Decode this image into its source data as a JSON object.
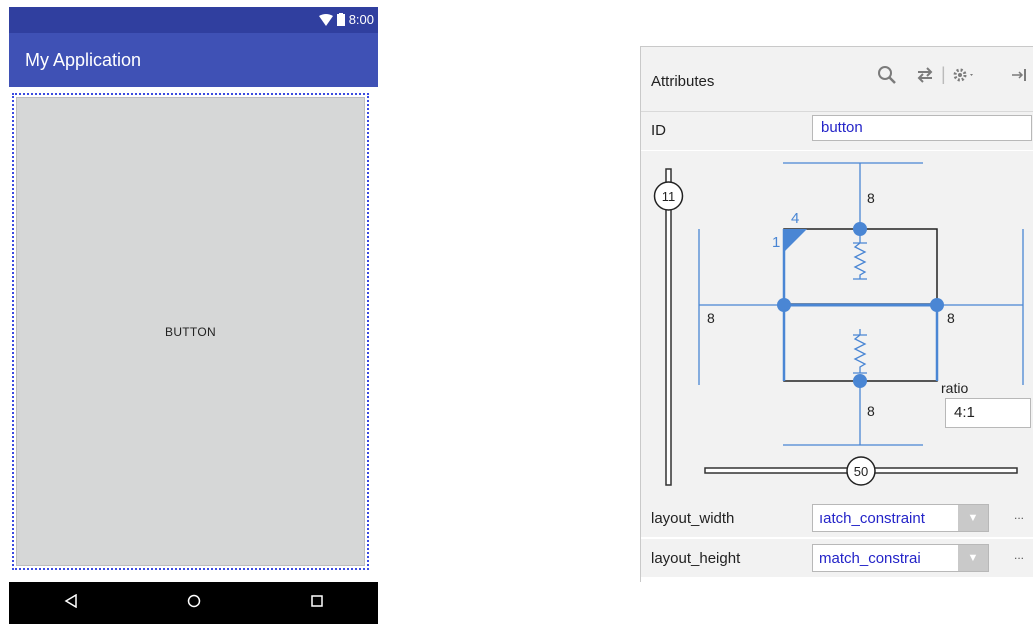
{
  "phone": {
    "time": "8:00",
    "app_title": "My Application",
    "button_label": "BUTTON",
    "nav": {
      "back_icon": "back-triangle-icon",
      "home_icon": "home-circle-icon",
      "recents_icon": "recents-square-icon"
    }
  },
  "panel": {
    "title": "Attributes",
    "id_label": "ID",
    "id_value": "button",
    "inspector": {
      "top_margin": "8",
      "bottom_margin": "8",
      "left_margin": "8",
      "right_margin": "8",
      "vertical_bias": "11",
      "horizontal_bias": "50",
      "ratio_label": "ratio",
      "ratio_value": "4:1",
      "ratio_numerator": "4",
      "ratio_denominator": "1"
    },
    "layout_width_label": "layout_width",
    "layout_width_value": "ıatch_constraint",
    "layout_height_label": "layout_height",
    "layout_height_value": "match_constrai",
    "more_label": "...",
    "colors": {
      "accent": "#4a86d4",
      "link": "#2424c8",
      "appbar": "#3f51b5",
      "statusbar": "#303f9f"
    }
  }
}
